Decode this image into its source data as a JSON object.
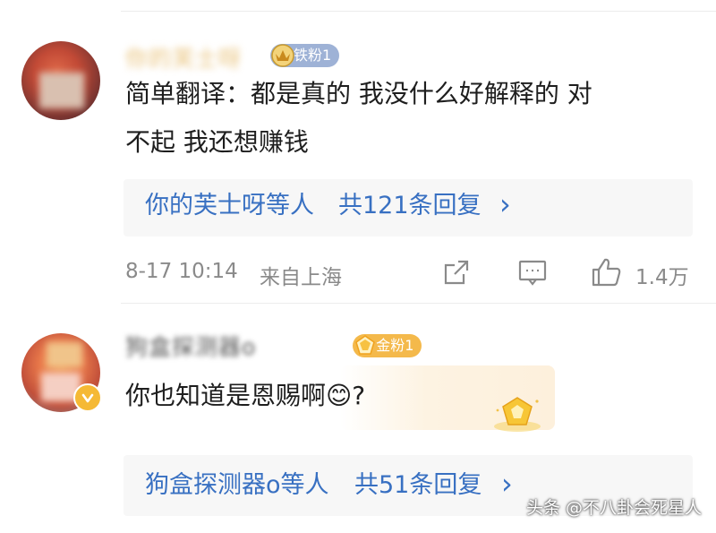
{
  "comments": [
    {
      "username": "你的芙士呀",
      "badge_label": "铁粉1",
      "badge_color": "#9eb2d6",
      "text_line1": "简单翻译：都是真的 我没什么好解释的 对",
      "text_line2": "不起 我还想赚钱",
      "reply_names": "你的芙士呀等人",
      "reply_count": "共121条回复",
      "reply_chevron": "›",
      "timestamp": "8-17 10:14",
      "location": "来自上海",
      "like_count": "1.4万",
      "icons": [
        "share-icon",
        "comment-icon",
        "like-icon"
      ]
    },
    {
      "username": "狗盒探测器o",
      "badge_label": "金粉1",
      "badge_color": "#f4b94b",
      "text": "你也知道是恩赐啊😊?",
      "reply_names": "狗盒探测器o等人",
      "reply_count": "共51条回复",
      "reply_chevron": "›",
      "verified_icon": "verified-badge-icon"
    }
  ],
  "watermark": "头条 @不八卦会死星人"
}
